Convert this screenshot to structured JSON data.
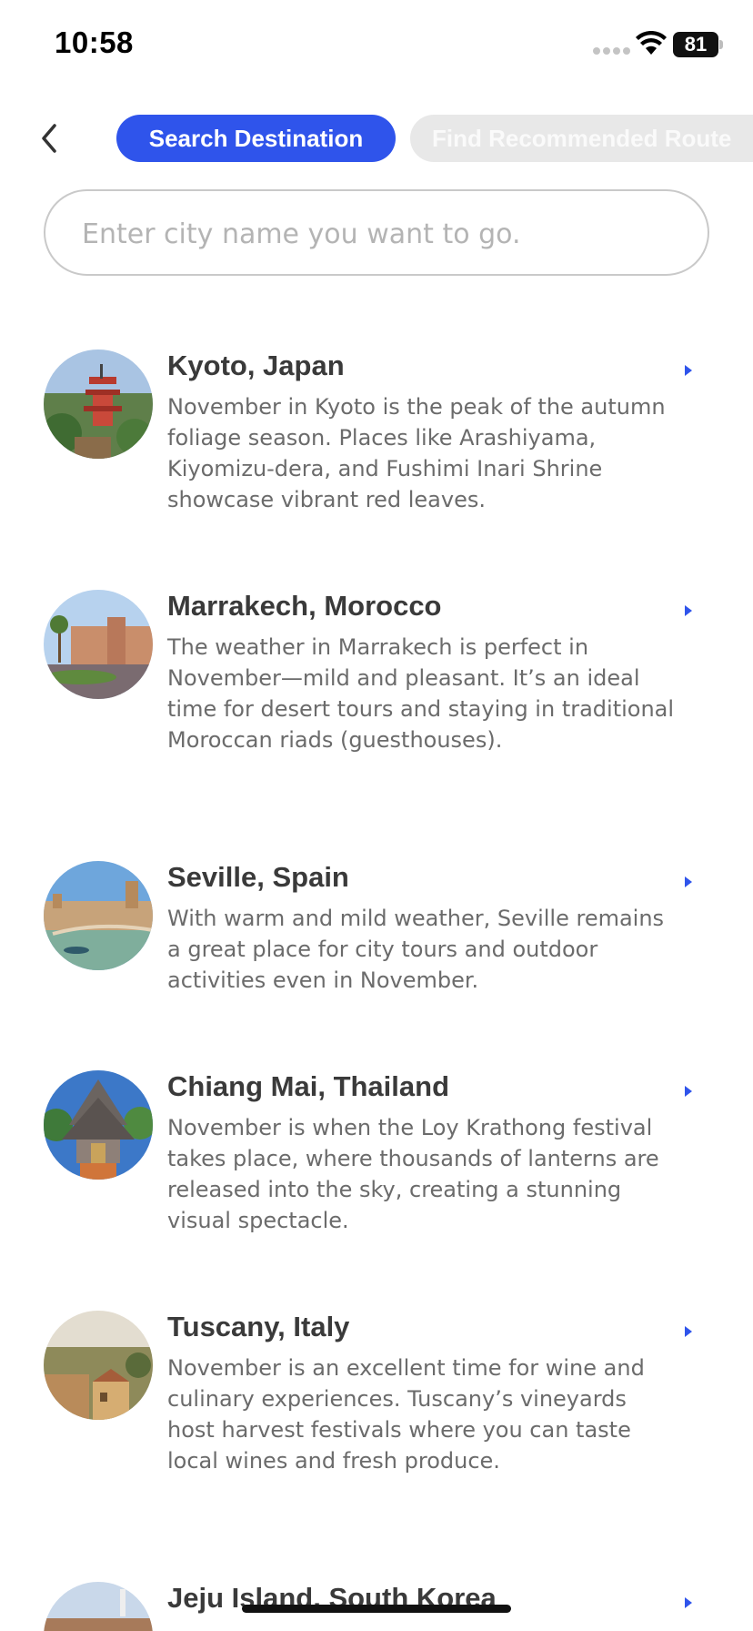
{
  "status_bar": {
    "time": "10:58",
    "battery": "81"
  },
  "tabs": [
    {
      "label": "Search Destination",
      "active": true
    },
    {
      "label": "Find Recommended Route",
      "active": false
    }
  ],
  "search": {
    "placeholder": "Enter city name you want to go.",
    "value": ""
  },
  "colors": {
    "accent": "#2f54eb",
    "title": "#3a3a3a",
    "desc": "#6b6b6b"
  },
  "destinations": [
    {
      "name": "Kyoto, Japan",
      "description": "November in Kyoto is the peak of the autumn foliage season. Places like Arashiyama, Kiyomizu-dera, and Fushimi Inari Shrine showcase vibrant red leaves."
    },
    {
      "name": "Marrakech, Morocco",
      "description": "The weather in Marrakech is perfect in November—mild and pleasant. It’s an ideal time for desert tours and staying in traditional Moroccan riads (guesthouses)."
    },
    {
      "name": "Seville, Spain",
      "description": "With warm and mild weather, Seville remains a great place for city tours and outdoor activities even in November."
    },
    {
      "name": "Chiang Mai, Thailand",
      "description": "November is when the Loy Krathong festival takes place, where thousands of lanterns are released into the sky, creating a stunning visual spectacle."
    },
    {
      "name": "Tuscany, Italy",
      "description": "November is an excellent time for wine and culinary experiences. Tuscany’s vineyards host harvest festivals where you can taste local wines and fresh produce."
    },
    {
      "name": "Jeju Island, South Korea",
      "description": ""
    }
  ]
}
